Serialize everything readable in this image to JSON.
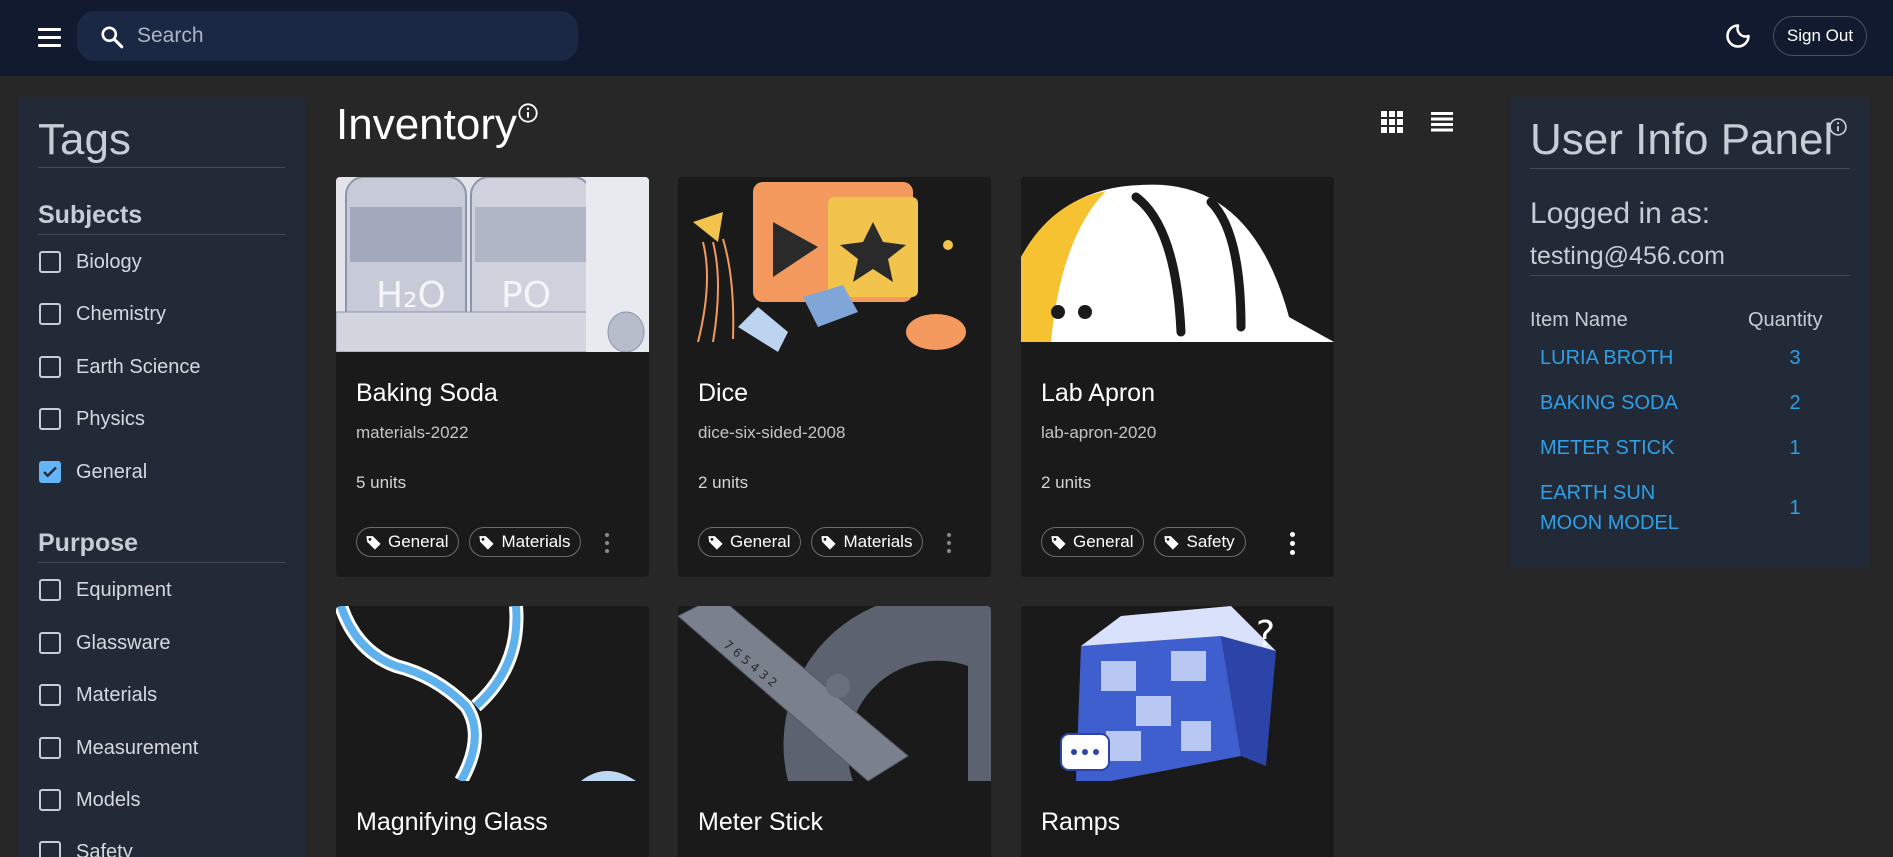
{
  "topbar": {
    "search_placeholder": "Search"
  },
  "signout_label": "Sign Out",
  "sidebar": {
    "title": "Tags",
    "subjects_heading": "Subjects",
    "subjects": [
      {
        "label": "Biology",
        "checked": false
      },
      {
        "label": "Chemistry",
        "checked": false
      },
      {
        "label": "Earth Science",
        "checked": false
      },
      {
        "label": "Physics",
        "checked": false
      },
      {
        "label": "General",
        "checked": true
      }
    ],
    "purpose_heading": "Purpose",
    "purposes": [
      {
        "label": "Equipment",
        "checked": false
      },
      {
        "label": "Glassware",
        "checked": false
      },
      {
        "label": "Materials",
        "checked": false
      },
      {
        "label": "Measurement",
        "checked": false
      },
      {
        "label": "Models",
        "checked": false
      },
      {
        "label": "Safety",
        "checked": false
      }
    ]
  },
  "main": {
    "title": "Inventory",
    "cards": [
      {
        "name": "Baking Soda",
        "id": "materials-2022",
        "qty": "5 units",
        "tags": [
          "General",
          "Materials"
        ]
      },
      {
        "name": "Dice",
        "id": "dice-six-sided-2008",
        "qty": "2 units",
        "tags": [
          "General",
          "Materials"
        ]
      },
      {
        "name": "Lab Apron",
        "id": "lab-apron-2020",
        "qty": "2 units",
        "tags": [
          "General",
          "Safety"
        ]
      },
      {
        "name": "Magnifying Glass",
        "id": "",
        "qty": "",
        "tags": []
      },
      {
        "name": "Meter Stick",
        "id": "",
        "qty": "",
        "tags": []
      },
      {
        "name": "Ramps",
        "id": "",
        "qty": "",
        "tags": []
      }
    ]
  },
  "panel": {
    "title": "User Info Panel",
    "logged_in_label": "Logged in as:",
    "email": "testing@456.com",
    "col_item": "Item Name",
    "col_qty": "Quantity",
    "rows": [
      {
        "name": "LURIA BROTH",
        "qty": "3"
      },
      {
        "name": "BAKING SODA",
        "qty": "2"
      },
      {
        "name": "METER STICK",
        "qty": "1"
      },
      {
        "name": "EARTH SUN MOON MODEL",
        "qty": "1"
      }
    ]
  },
  "colors": {
    "topbar": "#121a2f",
    "background": "#272727",
    "panel": "#222a38",
    "card": "#1a1a1a",
    "accent": "#64b5f6",
    "link": "#2f9fe6"
  }
}
